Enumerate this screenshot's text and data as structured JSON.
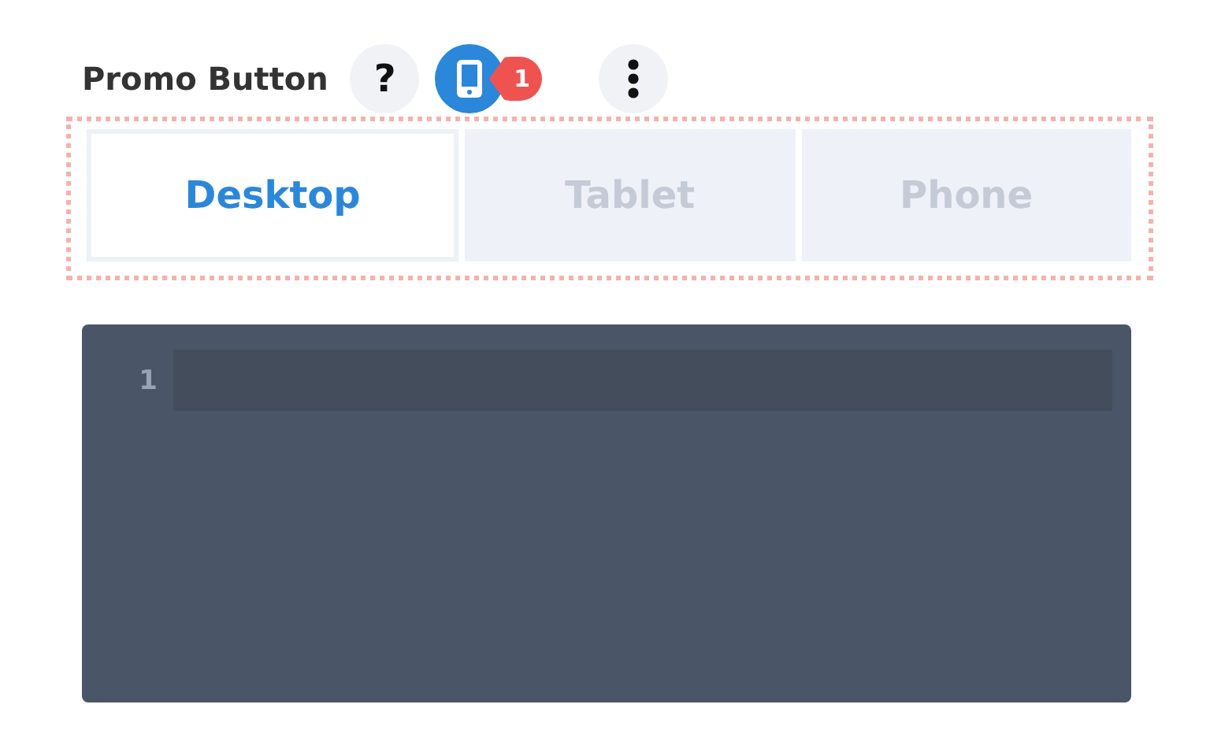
{
  "header": {
    "title": "Promo Button",
    "help_label": "?",
    "badge": "1"
  },
  "tabs": [
    {
      "label": "Desktop",
      "selected": true
    },
    {
      "label": "Tablet",
      "selected": false
    },
    {
      "label": "Phone",
      "selected": false
    }
  ],
  "editor": {
    "lines": [
      {
        "number": "1"
      }
    ]
  }
}
